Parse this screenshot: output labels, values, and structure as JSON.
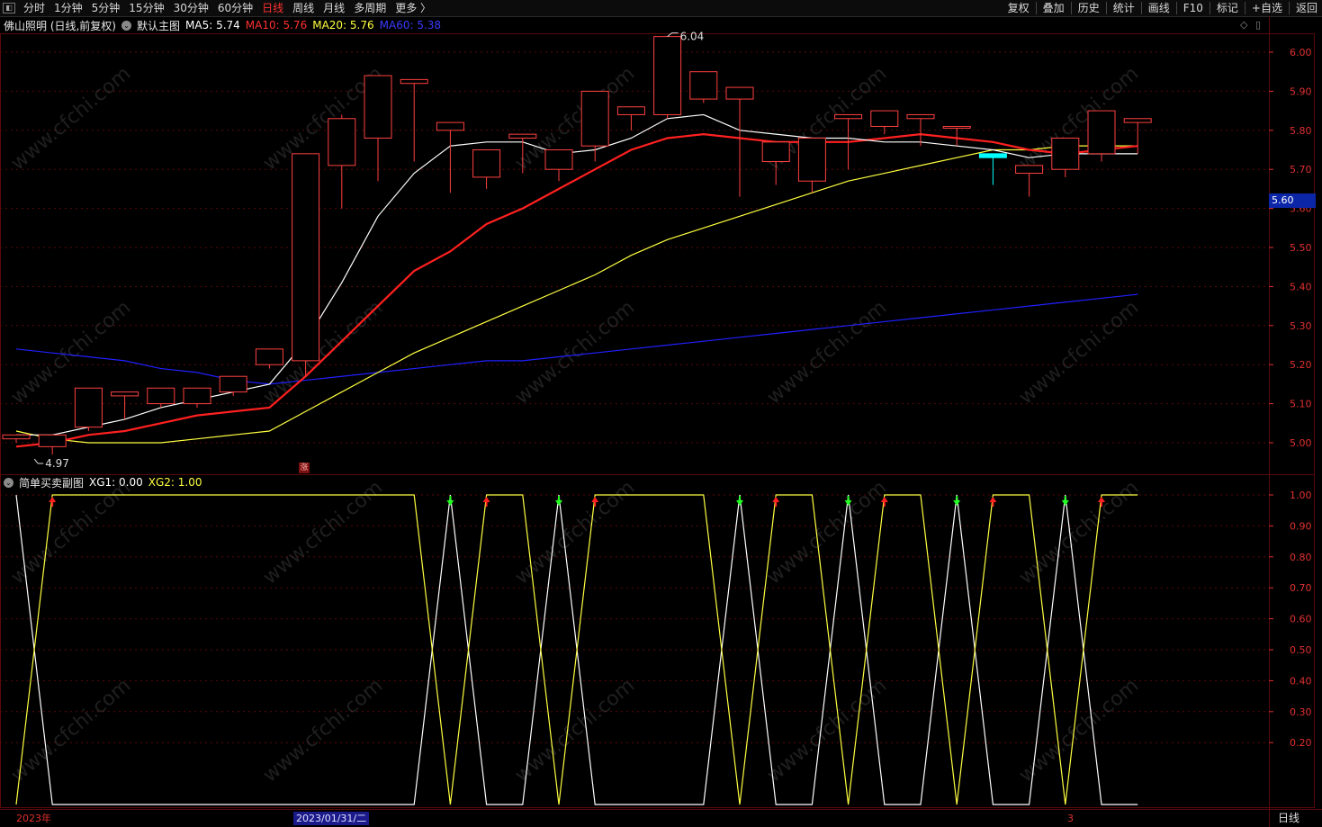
{
  "toolbar": {
    "periods": [
      "分时",
      "1分钟",
      "5分钟",
      "15分钟",
      "30分钟",
      "60分钟",
      "日线",
      "周线",
      "月线",
      "多周期",
      "更多 〉"
    ],
    "active_period": "日线",
    "actions": [
      "复权",
      "叠加",
      "历史",
      "统计",
      "画线",
      "F10",
      "标记",
      "+自选",
      "返回"
    ]
  },
  "main_legend": {
    "stock": "佛山照明 (日线,前复权)",
    "template": "默认主图",
    "ma5": "MA5: 5.74",
    "ma10": "MA10: 5.76",
    "ma20": "MA20: 5.76",
    "ma60": "MA60: 5.38"
  },
  "sub_legend": {
    "indicator": "简单买卖副图",
    "xg1": "XG1: 0.00",
    "xg2": "XG2: 1.00"
  },
  "colors": {
    "up": "#ff4040",
    "down": "#00ffff",
    "ma5": "#ffffff",
    "ma10": "#ff2020",
    "ma20": "#ffff40",
    "ma60": "#2020ff",
    "axis": "#e03030",
    "grid": "#5a0a0a"
  },
  "price_axis": [
    "6.00",
    "5.90",
    "5.80",
    "5.70",
    "5.60",
    "5.50",
    "5.40",
    "5.30",
    "5.20",
    "5.10",
    "5.00"
  ],
  "sub_axis": [
    "1.00",
    "0.90",
    "0.80",
    "0.70",
    "0.60",
    "0.50",
    "0.40",
    "0.30",
    "0.20"
  ],
  "last_price": "5.60",
  "high_label": "6.04",
  "low_label": "4.97",
  "zhang_label": "涨",
  "x_labels": {
    "start": "2023年",
    "cursor_date": "2023/01/31/二",
    "month": "3"
  },
  "period_label": "日线",
  "watermark": "www.cfchi.com",
  "chart_data": {
    "type": "candlestick",
    "ohlc": [
      [
        5.01,
        5.02,
        5.0,
        5.0
      ],
      [
        4.99,
        5.02,
        4.97,
        5.01
      ],
      [
        5.04,
        5.14,
        5.03,
        5.12
      ],
      [
        5.12,
        5.13,
        5.06,
        5.07
      ],
      [
        5.1,
        5.14,
        5.09,
        5.12
      ],
      [
        5.1,
        5.14,
        5.09,
        5.14
      ],
      [
        5.13,
        5.17,
        5.12,
        5.16
      ],
      [
        5.2,
        5.24,
        5.19,
        5.21
      ],
      [
        5.21,
        5.74,
        5.17,
        5.74
      ],
      [
        5.71,
        5.83,
        5.6,
        5.84
      ],
      [
        5.78,
        5.94,
        5.67,
        5.84
      ],
      [
        5.92,
        5.93,
        5.72,
        5.8
      ],
      [
        5.8,
        5.82,
        5.64,
        5.67
      ],
      [
        5.68,
        5.75,
        5.65,
        5.73
      ],
      [
        5.78,
        5.79,
        5.69,
        5.71
      ],
      [
        5.7,
        5.75,
        5.67,
        5.75
      ],
      [
        5.76,
        5.9,
        5.72,
        5.84
      ],
      [
        5.84,
        5.86,
        5.8,
        5.82
      ],
      [
        5.84,
        6.04,
        5.83,
        5.89
      ],
      [
        5.88,
        5.95,
        5.87,
        5.88
      ],
      [
        5.88,
        5.91,
        5.63,
        5.72
      ],
      [
        5.72,
        5.77,
        5.66,
        5.67
      ],
      [
        5.67,
        5.78,
        5.64,
        5.77
      ],
      [
        5.83,
        5.84,
        5.7,
        5.82
      ],
      [
        5.81,
        5.85,
        5.79,
        5.84
      ],
      [
        5.83,
        5.84,
        5.76,
        5.78
      ],
      [
        5.81,
        5.81,
        5.76,
        5.75
      ],
      [
        5.74,
        5.73,
        5.66,
        5.67
      ],
      [
        5.69,
        5.71,
        5.63,
        5.7
      ],
      [
        5.7,
        5.78,
        5.68,
        5.73
      ],
      [
        5.74,
        5.85,
        5.72,
        5.82
      ],
      [
        5.82,
        5.83,
        5.74,
        5.76
      ]
    ],
    "ma5": [
      5.02,
      5.02,
      5.04,
      5.06,
      5.09,
      5.11,
      5.13,
      5.15,
      5.26,
      5.41,
      5.58,
      5.69,
      5.76,
      5.77,
      5.77,
      5.74,
      5.75,
      5.78,
      5.83,
      5.84,
      5.8,
      5.79,
      5.78,
      5.78,
      5.77,
      5.77,
      5.76,
      5.75,
      5.73,
      5.74,
      5.74,
      5.74
    ],
    "ma10": [
      4.99,
      5.0,
      5.02,
      5.03,
      5.05,
      5.07,
      5.08,
      5.09,
      5.17,
      5.26,
      5.35,
      5.44,
      5.49,
      5.56,
      5.6,
      5.65,
      5.7,
      5.75,
      5.78,
      5.79,
      5.78,
      5.77,
      5.77,
      5.77,
      5.78,
      5.79,
      5.78,
      5.77,
      5.75,
      5.74,
      5.75,
      5.76
    ],
    "ma20": [
      5.03,
      5.01,
      5.0,
      5.0,
      5.0,
      5.01,
      5.02,
      5.03,
      5.08,
      5.13,
      5.18,
      5.23,
      5.27,
      5.31,
      5.35,
      5.39,
      5.43,
      5.48,
      5.52,
      5.55,
      5.58,
      5.61,
      5.64,
      5.67,
      5.69,
      5.71,
      5.73,
      5.75,
      5.75,
      5.76,
      5.76,
      5.76
    ],
    "ma60": [
      5.24,
      5.23,
      5.22,
      5.21,
      5.19,
      5.18,
      5.16,
      5.15,
      5.16,
      5.17,
      5.18,
      5.19,
      5.2,
      5.21,
      5.21,
      5.22,
      5.23,
      5.24,
      5.25,
      5.26,
      5.27,
      5.28,
      5.29,
      5.3,
      5.31,
      5.32,
      5.33,
      5.34,
      5.35,
      5.36,
      5.37,
      5.38
    ],
    "xg1": [
      1,
      0,
      0,
      0,
      0,
      0,
      0,
      0,
      0,
      0,
      0,
      0,
      1,
      0,
      0,
      1,
      0,
      0,
      0,
      0,
      1,
      0,
      0,
      1,
      0,
      0,
      1,
      0,
      0,
      1,
      0,
      0
    ],
    "xg2": [
      0,
      1,
      1,
      1,
      1,
      1,
      1,
      1,
      1,
      1,
      1,
      1,
      0,
      1,
      1,
      0,
      1,
      1,
      1,
      1,
      0,
      1,
      1,
      0,
      1,
      1,
      0,
      1,
      1,
      0,
      1,
      1
    ],
    "ylim": [
      4.96,
      6.05
    ],
    "sub_ylim": [
      0,
      1
    ]
  }
}
